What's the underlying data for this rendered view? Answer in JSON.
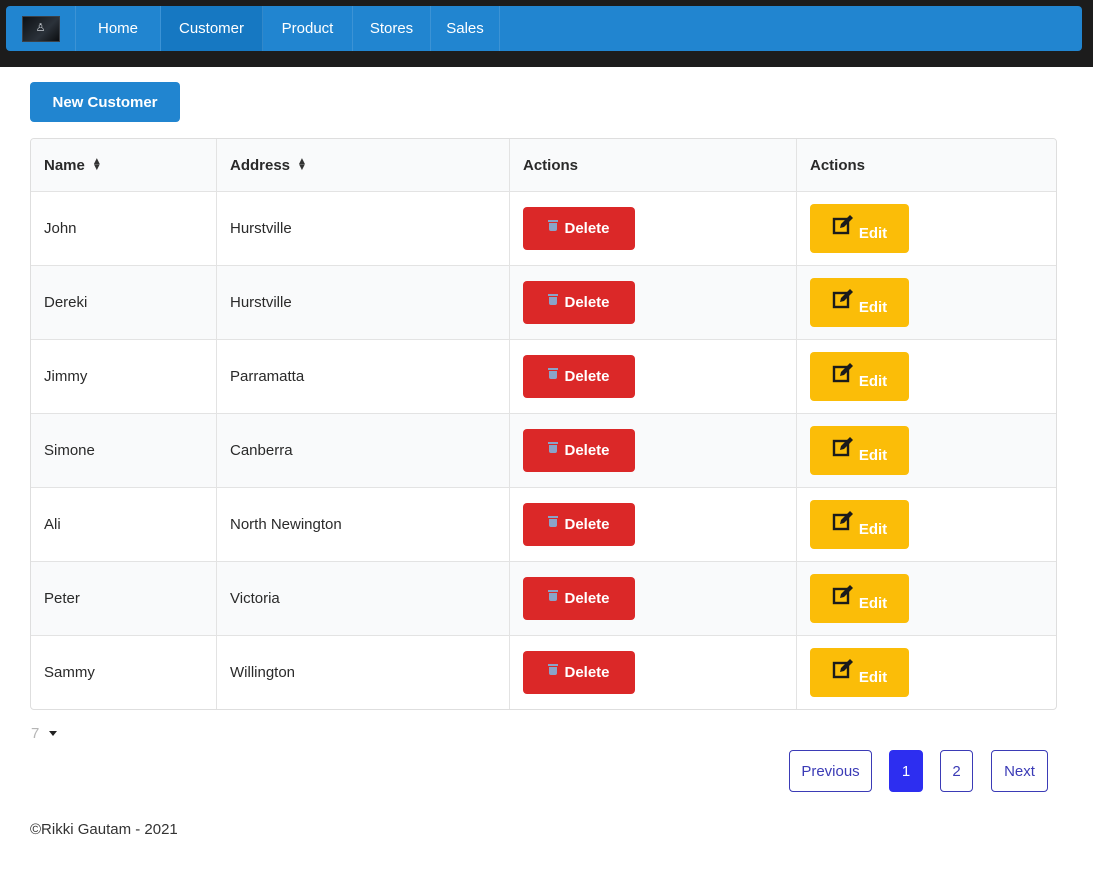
{
  "nav": {
    "logo_glyph": "♙",
    "items": [
      "Home",
      "Customer",
      "Product",
      "Stores",
      "Sales"
    ],
    "active": "Customer"
  },
  "toolbar": {
    "new_label": "New Customer"
  },
  "table": {
    "headers": [
      "Name",
      "Address",
      "Actions",
      "Actions"
    ],
    "delete_label": "Delete",
    "edit_label": "Edit",
    "rows": [
      {
        "name": "John",
        "address": "Hurstville"
      },
      {
        "name": "Dereki",
        "address": "Hurstville"
      },
      {
        "name": "Jimmy",
        "address": "Parramatta"
      },
      {
        "name": "Simone",
        "address": "Canberra"
      },
      {
        "name": "Ali",
        "address": "North Newington"
      },
      {
        "name": "Peter",
        "address": "Victoria"
      },
      {
        "name": "Sammy",
        "address": "Willington"
      }
    ]
  },
  "pagination": {
    "page_size": "7",
    "previous_label": "Previous",
    "pages": [
      "1",
      "2"
    ],
    "current_page": "1",
    "next_label": "Next"
  },
  "footer": {
    "text": "©Rikki Gautam - 2021"
  },
  "colors": {
    "menu": "#2185d0",
    "delete": "#db2828",
    "edit": "#fbbd08",
    "pager_active": "#2d2ef0"
  }
}
